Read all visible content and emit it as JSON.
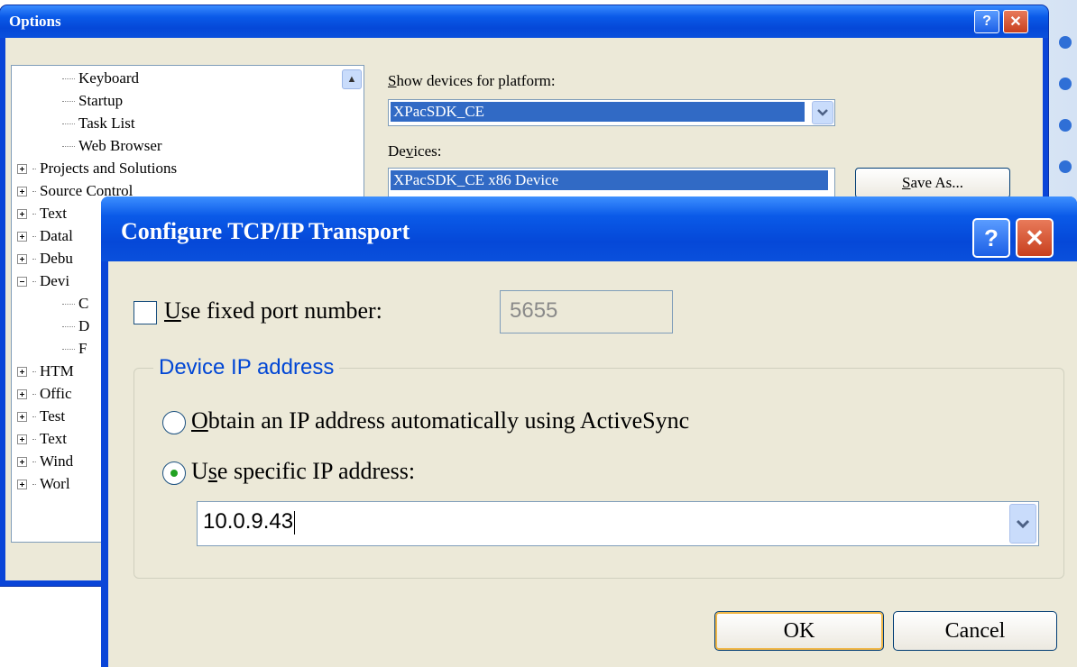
{
  "options_window": {
    "title": "Options",
    "help_label": "?",
    "close_label": "✕",
    "tree_items": [
      {
        "label": "Keyboard",
        "kind": "leaf"
      },
      {
        "label": "Startup",
        "kind": "leaf"
      },
      {
        "label": "Task List",
        "kind": "leaf"
      },
      {
        "label": "Web Browser",
        "kind": "leaf"
      },
      {
        "label": "Projects and Solutions",
        "kind": "collapsed"
      },
      {
        "label": "Source Control",
        "kind": "collapsed"
      },
      {
        "label": "Text",
        "kind": "collapsed"
      },
      {
        "label": "Datal",
        "kind": "collapsed"
      },
      {
        "label": "Debu",
        "kind": "collapsed"
      },
      {
        "label": "Devi",
        "kind": "expanded"
      },
      {
        "label": "C",
        "kind": "leaf"
      },
      {
        "label": "D",
        "kind": "leaf"
      },
      {
        "label": "F",
        "kind": "leaf"
      },
      {
        "label": "HTM",
        "kind": "collapsed"
      },
      {
        "label": "Offic",
        "kind": "collapsed"
      },
      {
        "label": "Test",
        "kind": "collapsed"
      },
      {
        "label": "Text",
        "kind": "collapsed"
      },
      {
        "label": "Wind",
        "kind": "collapsed"
      },
      {
        "label": "Worl",
        "kind": "collapsed"
      }
    ],
    "platform_label_pre": "S",
    "platform_label_post": "how devices for platform:",
    "platform_value": "XPacSDK_CE",
    "devices_label_pre": "De",
    "devices_label_u": "v",
    "devices_label_post": "ices:",
    "device_selected": "XPacSDK_CE x86 Device",
    "save_as_pre": "S",
    "save_as_post": "ave As..."
  },
  "tcp_dialog": {
    "title": "Configure TCP/IP Transport",
    "help_label": "?",
    "close_label": "✕",
    "fixed_port_u": "U",
    "fixed_port_post": "se fixed port number:",
    "fixed_port_checked": false,
    "port_value": "5655",
    "group_label": "Device IP address",
    "obtain_u": "O",
    "obtain_post": "btain an IP address automatically using ActiveSync",
    "obtain_selected": false,
    "specific_pre": "U",
    "specific_u": "s",
    "specific_post": "e specific IP address:",
    "specific_selected": true,
    "ip_value": "10.0.9.43",
    "ok_label": "OK",
    "cancel_label": "Cancel"
  },
  "colors": {
    "title_bar": "#0a50dc",
    "dialog_face": "#ece9d8",
    "selection": "#316ac5",
    "group_label": "#0046d5",
    "close_button": "#c8401e"
  }
}
